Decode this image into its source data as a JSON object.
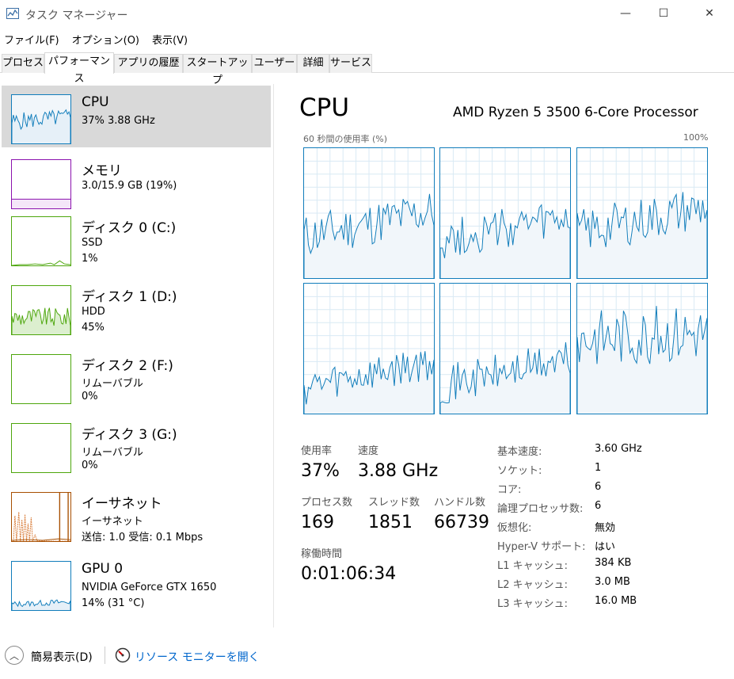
{
  "window": {
    "title": "タスク マネージャー",
    "min_glyph": "—",
    "max_glyph": "☐",
    "close_glyph": "✕"
  },
  "menu": [
    "ファイル(F)",
    "オプション(O)",
    "表示(V)"
  ],
  "tabs": [
    "プロセス",
    "パフォーマンス",
    "アプリの履歴",
    "スタートアップ",
    "ユーザー",
    "詳細",
    "サービス"
  ],
  "sidebar": [
    {
      "name": "CPU",
      "line1": "37% 3.88 GHz",
      "line2": "",
      "color": "#117dbb",
      "selected": true
    },
    {
      "name": "メモリ",
      "line1": "3.0/15.9 GB (19%)",
      "line2": "",
      "color": "#8b12ae",
      "selected": false
    },
    {
      "name": "ディスク 0 (C:)",
      "line1": "SSD",
      "line2": "1%",
      "color": "#4da60c",
      "selected": false
    },
    {
      "name": "ディスク 1 (D:)",
      "line1": "HDD",
      "line2": "45%",
      "color": "#4da60c",
      "selected": false
    },
    {
      "name": "ディスク 2 (F:)",
      "line1": "リムーバブル",
      "line2": "0%",
      "color": "#4da60c",
      "selected": false
    },
    {
      "name": "ディスク 3 (G:)",
      "line1": "リムーバブル",
      "line2": "0%",
      "color": "#4da60c",
      "selected": false
    },
    {
      "name": "イーサネット",
      "line1": "イーサネット",
      "line2": "送信: 1.0 受信: 0.1 Mbps",
      "color": "#a74f01",
      "selected": false
    },
    {
      "name": "GPU 0",
      "line1": "NVIDIA GeForce GTX 1650",
      "line2": "14% (31 °C)",
      "color": "#117dbb",
      "selected": false
    }
  ],
  "main": {
    "title": "CPU",
    "subtitle": "AMD Ryzen 5 3500 6-Core Processor",
    "graph_label": "60 秒間の使用率 (%)",
    "graph_max": "100%"
  },
  "stats": {
    "usage_label": "使用率",
    "usage": "37%",
    "speed_label": "速度",
    "speed": "3.88 GHz",
    "proc_label": "プロセス数",
    "proc": "169",
    "thread_label": "スレッド数",
    "thread": "1851",
    "handle_label": "ハンドル数",
    "handle": "66739",
    "uptime_label": "稼働時間",
    "uptime": "0:01:06:34"
  },
  "specs": [
    {
      "k": "基本速度:",
      "v": "3.60 GHz"
    },
    {
      "k": "ソケット:",
      "v": "1"
    },
    {
      "k": "コア:",
      "v": "6"
    },
    {
      "k": "論理プロセッサ数:",
      "v": "6"
    },
    {
      "k": "仮想化:",
      "v": "無効"
    },
    {
      "k": "Hyper-V サポート:",
      "v": "はい"
    },
    {
      "k": "L1 キャッシュ:",
      "v": "384 KB"
    },
    {
      "k": "L2 キャッシュ:",
      "v": "3.0 MB"
    },
    {
      "k": "L3 キャッシュ:",
      "v": "16.0 MB"
    }
  ],
  "footer": {
    "simple_view": "簡易表示(D)",
    "resource_monitor": "リソース モニターを開く",
    "chevron": "︿"
  },
  "colors": {
    "cpu": "#117dbb",
    "memory": "#8b12ae",
    "disk": "#4da60c",
    "ethernet": "#a74f01",
    "selected_bg": "#d9d9d9",
    "link": "#0066cc"
  },
  "icons": {
    "app": "task-manager-icon",
    "footer_collapse": "chevron-up-icon",
    "resource_monitor": "resource-monitor-icon"
  }
}
